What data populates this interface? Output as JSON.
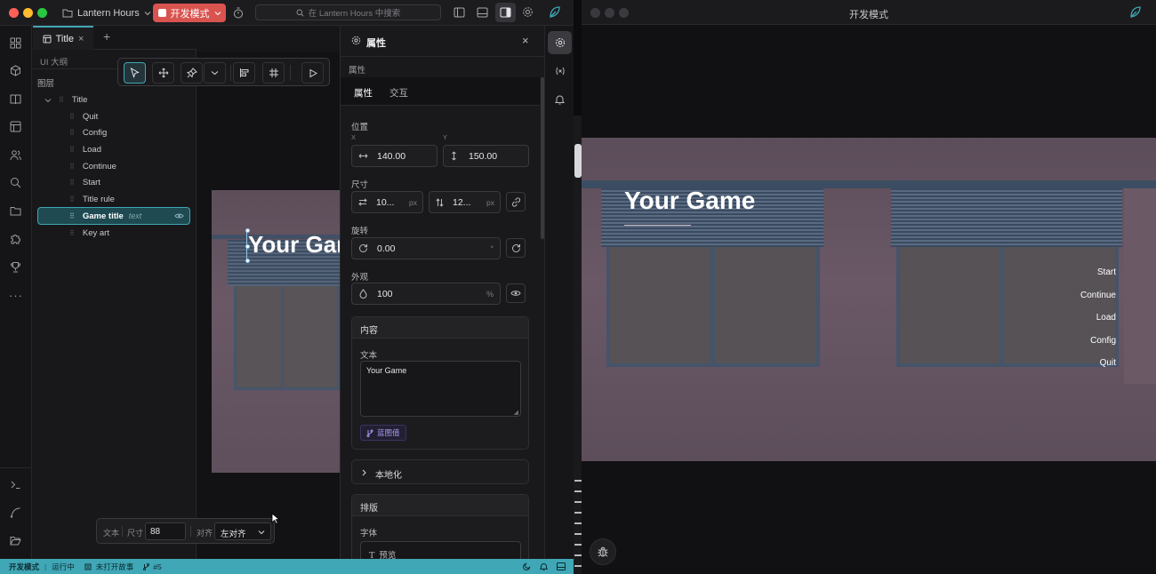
{
  "app": {
    "project": "Lantern Hours",
    "mode_button": "开发模式",
    "search_placeholder": "在 Lantern Hours 中搜索"
  },
  "tabs": [
    {
      "label": "Title",
      "close": "×"
    }
  ],
  "tabs_add": "+",
  "outline": {
    "header": "UI 大纲",
    "layers_label": "图层",
    "items": [
      {
        "label": "Title",
        "type": ""
      },
      {
        "label": "Quit",
        "type": ""
      },
      {
        "label": "Config",
        "type": ""
      },
      {
        "label": "Load",
        "type": ""
      },
      {
        "label": "Continue",
        "type": ""
      },
      {
        "label": "Start",
        "type": ""
      },
      {
        "label": "Title rule",
        "type": ""
      },
      {
        "label": "Game title",
        "type": "text"
      },
      {
        "label": "Key art",
        "type": ""
      }
    ]
  },
  "canvas": {
    "title_text": "Your Gar"
  },
  "text_toolbar": {
    "label_text": "文本",
    "label_size": "尺寸",
    "size_value": "88",
    "label_align": "对齐",
    "align_value": "左对齐"
  },
  "properties": {
    "header": "属性",
    "sub_header": "属性",
    "tabs": [
      "属性",
      "交互"
    ],
    "position_label": "位置",
    "x_label": "X",
    "y_label": "Y",
    "x_value": "140.00",
    "y_value": "150.00",
    "size_label": "尺寸",
    "w_value": "10...",
    "h_value": "12...",
    "unit": "px",
    "rotation_label": "旋转",
    "rotation_value": "0.00",
    "rotation_unit": "°",
    "appearance_label": "外观",
    "opacity_value": "100",
    "opacity_unit": "%",
    "content_header": "内容",
    "text_label": "文本",
    "text_value": "Your Game",
    "blueprint_button": "蓝图值",
    "localization": "本地化",
    "layout_header": "排版",
    "font_label": "字体",
    "font_preview": "预览"
  },
  "status": {
    "mode": "开发模式",
    "running": "运行中",
    "story": "未打开故事",
    "branch": "#5"
  },
  "preview": {
    "window_title": "开发模式",
    "game_title": "Your Game",
    "menu": [
      "Start",
      "Continue",
      "Load",
      "Config",
      "Quit"
    ]
  },
  "colors": {
    "accent": "#3fa7b6",
    "mode_red": "#d9534f",
    "selection": "#1f4a52"
  }
}
